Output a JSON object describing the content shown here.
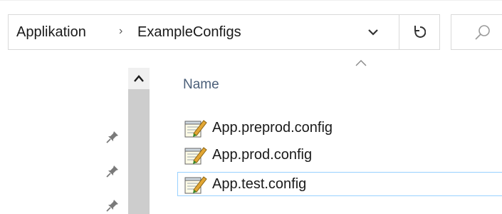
{
  "breadcrumb": {
    "root": "Applikation",
    "separator": "›",
    "current": "ExampleConfigs"
  },
  "icons": {
    "dropdown": "chevron-down-icon",
    "refresh": "refresh-icon",
    "search": "search-icon",
    "scroll_up": "chevron-up-icon",
    "pin": "pin-icon",
    "sort": "sort-ascending-icon",
    "file": "config-file-icon"
  },
  "file_list": {
    "column_header": "Name",
    "sort_direction": "ascending",
    "files": [
      {
        "name": "App.preprod.config"
      },
      {
        "name": "App.prod.config"
      },
      {
        "name": "App.test.config",
        "focused": true
      }
    ]
  },
  "colors": {
    "header_text": "#4c607a",
    "focus_border": "#99d1ff",
    "border": "#d9d9d9"
  }
}
